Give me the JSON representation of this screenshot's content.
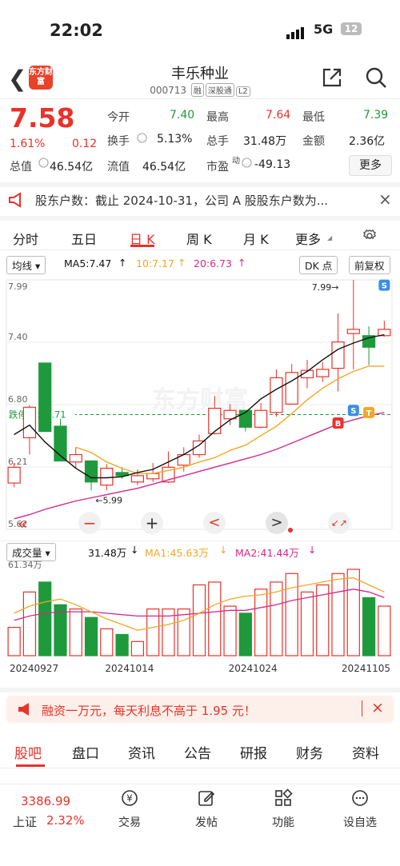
{
  "status": {
    "time": "22:02",
    "network": "5G",
    "battery": "12"
  },
  "header": {
    "logo": "东方财富",
    "name": "丰乐种业",
    "code": "000713",
    "tags": [
      "融",
      "深股通",
      "L2"
    ]
  },
  "quote": {
    "price": "7.58",
    "pct": "1.61%",
    "change": "0.12",
    "rows": [
      [
        {
          "label": "今开",
          "value": "7.40",
          "color": "green"
        },
        {
          "label": "最高",
          "value": "7.64",
          "color": "red"
        },
        {
          "label": "最低",
          "value": "7.39",
          "color": "green"
        }
      ],
      [
        {
          "label": "换手",
          "value": "5.13%",
          "color": "dark"
        },
        {
          "label": "总手",
          "value": "31.48万",
          "color": "dark"
        },
        {
          "label": "金额",
          "value": "2.36亿",
          "color": "dark"
        }
      ]
    ],
    "total_value_label": "总值",
    "total_value": "46.54亿",
    "float_label": "流值",
    "float_value": "46.54亿",
    "pe_label": "市盈",
    "pe_sup": "动",
    "pe_value": "-49.13",
    "more": "更多"
  },
  "notice": {
    "text": "股东户数：截止 2024-10-31，公司 A 股股东户数为..."
  },
  "tabs": [
    "分时",
    "五日",
    "日 K",
    "周 K",
    "月 K",
    "更多"
  ],
  "chart_toolbar": {
    "ma_select": "均线",
    "ma5": "MA5:7.47",
    "ma10": "10:7.17",
    "ma20": "20:6.73",
    "dk": "DK 点",
    "fq": "前复权"
  },
  "vol_toolbar": {
    "select": "成交量",
    "vol": "31.48万",
    "ma1": "MA1:45.63万",
    "ma2": "MA2:41.44万"
  },
  "colors": {
    "up": "#e8322a",
    "down": "#1e9a3c",
    "ma5": "#111111",
    "ma10": "#f5a623",
    "ma20": "#d6288c",
    "limit": "#1e9a3c"
  },
  "chart_data": {
    "type": "candlestick",
    "y_ticks": [
      "7.99",
      "7.40",
      "6.80",
      "6.21",
      "5.62"
    ],
    "ylim": [
      5.62,
      7.99
    ],
    "limit_line": {
      "label": "跌停价：",
      "value": "6.71"
    },
    "annotations": {
      "high": "7.99",
      "low": "5.99"
    },
    "markers": [
      "S",
      "S",
      "T",
      "B",
      "S"
    ],
    "candles": [
      {
        "o": 6.06,
        "c": 6.21,
        "h": 6.25,
        "l": 6.02
      },
      {
        "o": 6.49,
        "c": 6.78,
        "h": 6.8,
        "l": 6.33
      },
      {
        "o": 7.2,
        "c": 6.55,
        "h": 7.2,
        "l": 6.55
      },
      {
        "o": 6.6,
        "c": 6.27,
        "h": 6.67,
        "l": 6.27
      },
      {
        "o": 6.26,
        "c": 6.33,
        "h": 6.4,
        "l": 6.2
      },
      {
        "o": 6.27,
        "c": 6.07,
        "h": 6.27,
        "l": 5.99
      },
      {
        "o": 6.04,
        "c": 6.2,
        "h": 6.24,
        "l": 5.99
      },
      {
        "o": 6.16,
        "c": 6.13,
        "h": 6.21,
        "l": 6.1
      },
      {
        "o": 6.07,
        "c": 6.13,
        "h": 6.19,
        "l": 6.04
      },
      {
        "o": 6.1,
        "c": 6.15,
        "h": 6.25,
        "l": 6.07
      },
      {
        "o": 6.07,
        "c": 6.21,
        "h": 6.36,
        "l": 6.06
      },
      {
        "o": 6.23,
        "c": 6.33,
        "h": 6.4,
        "l": 6.17
      },
      {
        "o": 6.33,
        "c": 6.46,
        "h": 6.52,
        "l": 6.3
      },
      {
        "o": 6.53,
        "c": 6.77,
        "h": 6.89,
        "l": 6.52
      },
      {
        "o": 6.67,
        "c": 6.75,
        "h": 6.81,
        "l": 6.61
      },
      {
        "o": 6.75,
        "c": 6.59,
        "h": 6.75,
        "l": 6.55
      },
      {
        "o": 6.59,
        "c": 6.75,
        "h": 6.82,
        "l": 6.58
      },
      {
        "o": 6.73,
        "c": 7.06,
        "h": 7.14,
        "l": 6.69
      },
      {
        "o": 6.81,
        "c": 7.11,
        "h": 7.19,
        "l": 6.81
      },
      {
        "o": 7.06,
        "c": 7.13,
        "h": 7.23,
        "l": 6.96
      },
      {
        "o": 7.07,
        "c": 7.14,
        "h": 7.21,
        "l": 7.02
      },
      {
        "o": 7.15,
        "c": 7.4,
        "h": 7.67,
        "l": 6.93
      },
      {
        "o": 7.48,
        "c": 7.52,
        "h": 7.99,
        "l": 7.14
      },
      {
        "o": 7.46,
        "c": 7.35,
        "h": 7.55,
        "l": 7.18
      },
      {
        "o": 7.46,
        "c": 7.52,
        "h": 7.6,
        "l": 7.45
      }
    ],
    "ma5": [
      6.52,
      6.61,
      6.45,
      6.32,
      6.2,
      6.11,
      6.11,
      6.12,
      6.16,
      6.19,
      6.26,
      6.33,
      6.42,
      6.55,
      6.66,
      6.73,
      6.86,
      6.95,
      7.03,
      7.12,
      7.23,
      7.33,
      7.39,
      7.44,
      7.47
    ],
    "ma10": [
      null,
      null,
      null,
      null,
      6.4,
      6.35,
      6.26,
      6.2,
      6.15,
      6.15,
      6.18,
      6.21,
      6.26,
      6.3,
      6.37,
      6.42,
      6.51,
      6.6,
      6.72,
      6.85,
      6.96,
      7.05,
      7.12,
      7.17,
      7.17
    ],
    "ma20": [
      5.72,
      5.76,
      5.81,
      5.85,
      5.89,
      5.92,
      5.95,
      5.98,
      6.01,
      6.05,
      6.09,
      6.13,
      6.17,
      6.21,
      6.25,
      6.29,
      6.33,
      6.38,
      6.44,
      6.5,
      6.56,
      6.62,
      6.66,
      6.7,
      6.73
    ],
    "volume": {
      "max_label": "61.34万",
      "values": [
        20,
        45,
        52,
        36,
        33,
        27,
        19,
        15,
        10,
        33,
        33,
        33,
        50,
        52,
        35,
        30,
        47,
        52,
        58,
        45,
        50,
        58,
        61,
        41,
        35
      ],
      "ma1": [
        30,
        35,
        38,
        40,
        36,
        31,
        26,
        22,
        18,
        20,
        22,
        25,
        30,
        36,
        40,
        42,
        43,
        45,
        48,
        50,
        52,
        54,
        55,
        50,
        45
      ],
      "ma2": [
        25,
        28,
        30,
        31,
        31,
        31,
        30,
        29,
        28,
        28,
        28,
        29,
        30,
        31,
        32,
        32,
        34,
        36,
        39,
        41,
        43,
        45,
        47,
        45,
        41
      ],
      "x_labels": [
        "20240927",
        "20241014",
        "20241024",
        "20241105"
      ]
    }
  },
  "chart_controls": [
    "«",
    "−",
    "+",
    "<",
    ">",
    "↙↗"
  ],
  "promo": {
    "text": "融资一万元，每天利息不高于 1.95 元！"
  },
  "bottom_tabs": [
    "股吧",
    "盘口",
    "资讯",
    "公告",
    "研报",
    "财务",
    "资料"
  ],
  "footer": {
    "index_value": "3386.99",
    "index_name": "上证",
    "index_pct": "2.32%",
    "nav": [
      "交易",
      "发帖",
      "功能",
      "设自选"
    ]
  }
}
